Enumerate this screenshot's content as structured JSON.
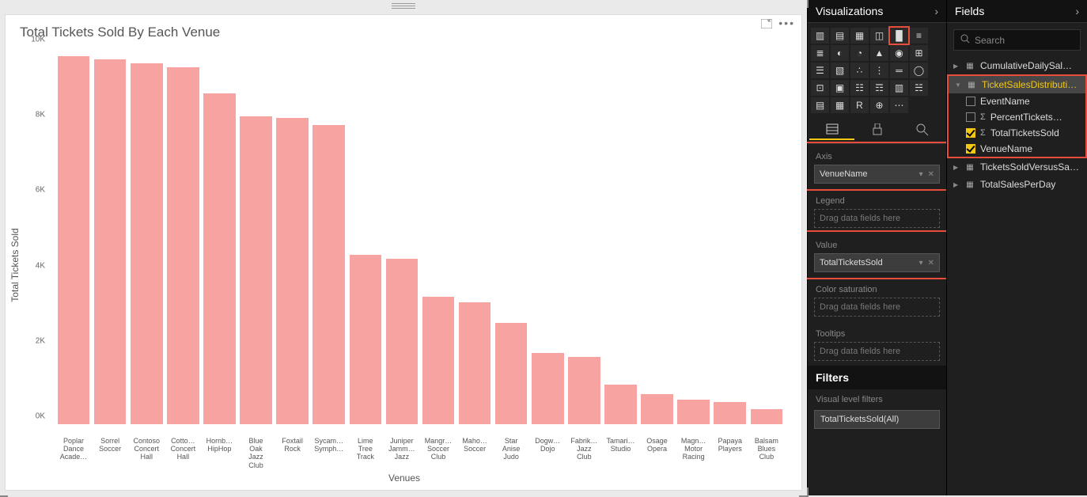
{
  "chart_data": {
    "type": "bar",
    "title": "Total Tickets Sold By Each Venue",
    "xlabel": "Venues",
    "ylabel": "Total Tickets Sold",
    "ylim": [
      0,
      10000
    ],
    "yticks": [
      "0K",
      "2K",
      "4K",
      "6K",
      "8K",
      "10K"
    ],
    "categories": [
      "Poplar Dance Acade…",
      "Sorrel Soccer",
      "Contoso Concert Hall",
      "Cotto… Concert Hall",
      "Hornb… HipHop",
      "Blue Oak Jazz Club",
      "Foxtail Rock",
      "Sycam… Symph…",
      "Lime Tree Track",
      "Juniper Jamm… Jazz",
      "Mangr… Soccer Club",
      "Maho… Soccer",
      "Star Anise Judo",
      "Dogw… Dojo",
      "Fabrik… Jazz Club",
      "Tamari… Studio",
      "Osage Opera",
      "Magn… Motor Racing",
      "Papaya Players",
      "Balsam Blues Club"
    ],
    "values": [
      9800,
      9700,
      9600,
      9500,
      8800,
      8200,
      8150,
      7950,
      4500,
      4400,
      3400,
      3250,
      2700,
      1900,
      1800,
      1050,
      800,
      650,
      580,
      400
    ]
  },
  "vis_panel": {
    "title": "Visualizations",
    "wells": {
      "axis_label": "Axis",
      "axis_value": "VenueName",
      "legend_label": "Legend",
      "legend_placeholder": "Drag data fields here",
      "value_label": "Value",
      "value_value": "TotalTicketsSold",
      "csat_label": "Color saturation",
      "csat_placeholder": "Drag data fields here",
      "tooltips_label": "Tooltips",
      "tooltips_placeholder": "Drag data fields here"
    },
    "filters": {
      "header": "Filters",
      "sub": "Visual level filters",
      "item": "TotalTicketsSold(All)"
    }
  },
  "fields_panel": {
    "title": "Fields",
    "search_placeholder": "Search",
    "tables": [
      {
        "name": "CumulativeDailySal…",
        "expanded": false
      },
      {
        "name": "TicketSalesDistributi…",
        "expanded": true,
        "highlight": true,
        "fields": [
          {
            "name": "EventName",
            "checked": false,
            "agg": false
          },
          {
            "name": "PercentTickets…",
            "checked": false,
            "agg": true
          },
          {
            "name": "TotalTicketsSold",
            "checked": true,
            "agg": true
          },
          {
            "name": "VenueName",
            "checked": true,
            "agg": false
          }
        ]
      },
      {
        "name": "TicketsSoldVersusSa…",
        "expanded": false
      },
      {
        "name": "TotalSalesPerDay",
        "expanded": false
      }
    ]
  }
}
